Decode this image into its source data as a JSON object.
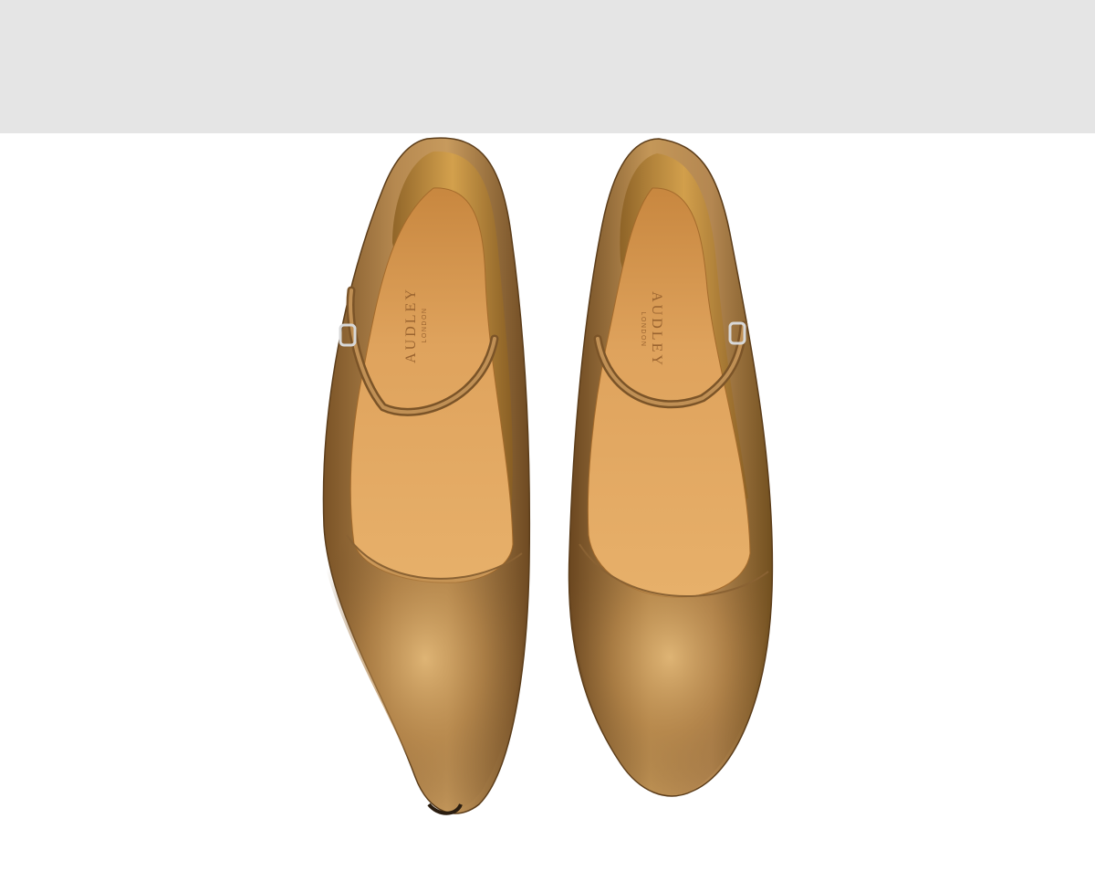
{
  "banner": {
    "color": "#e5e5e5"
  },
  "product": {
    "left_shoe": {
      "insole_brand": "AUDLEY",
      "insole_subtitle": "LONDON"
    },
    "right_shoe": {
      "insole_brand": "AUDLEY",
      "insole_subtitle": "LONDON"
    },
    "colors": {
      "leather": "#a67c45",
      "leather_dark": "#6e4b22",
      "leather_light": "#d8ae6f",
      "insole": "#d79a55",
      "background": "#ffffff"
    }
  }
}
